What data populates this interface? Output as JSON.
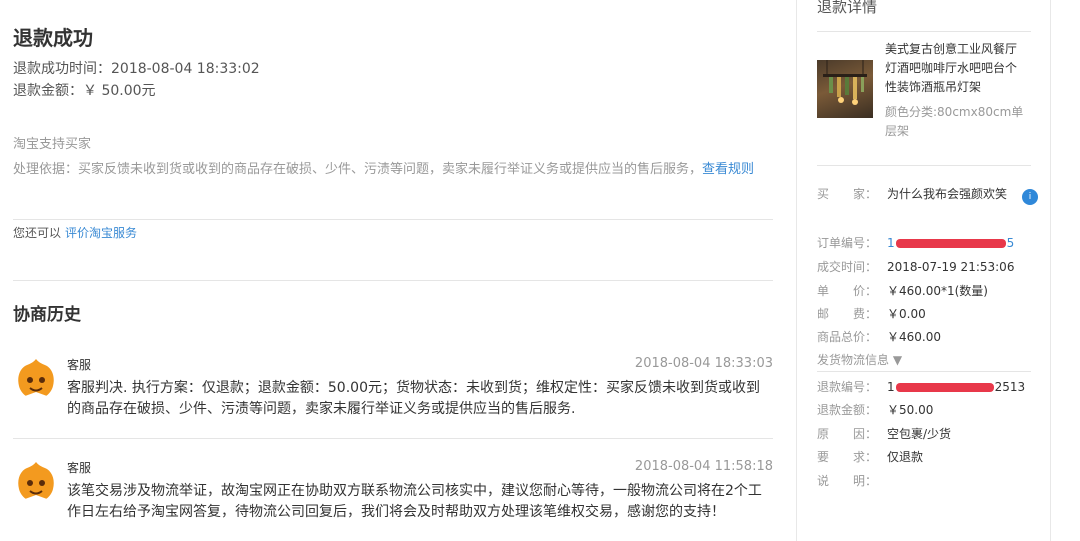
{
  "main": {
    "title": "退款成功",
    "success_time": "退款成功时间：2018-08-04 18:33:02",
    "refund_amount": "退款金额：￥ 50.00元",
    "support_head": "淘宝支持买家",
    "basis_text": "处理依据：买家反馈未收到货或收到的商品存在破损、少件、污渍等问题，卖家未履行举证义务或提供应当的售后服务，",
    "rule_link": "查看规则",
    "also_text": "您还可以",
    "evaluate_link": "评价淘宝服务",
    "history_title": "协商历史",
    "history": [
      {
        "role": "客服",
        "time": "2018-08-04 18:33:03",
        "text": "客服判决. 执行方案：仅退款；退款金额：50.00元；货物状态：未收到货；维权定性：买家反馈未收到货或收到的商品存在破损、少件、污渍等问题，卖家未履行举证义务或提供应当的售后服务."
      },
      {
        "role": "客服",
        "time": "2018-08-04 11:58:18",
        "text": "该笔交易涉及物流举证，故淘宝网正在协助双方联系物流公司核实中，建议您耐心等待，一般物流公司将在2个工作日左右给予淘宝网答复，待物流公司回复后，我们将会及时帮助双方处理该笔维权交易，感谢您的支持！"
      }
    ]
  },
  "sidebar": {
    "title": "退款详情",
    "product_name": "美式复古创意工业风餐厅灯酒吧咖啡厅水吧吧台个性装饰酒瓶吊灯架",
    "product_spec": "颜色分类:80cmx80cm单层架",
    "buyer_label": "买　　家：",
    "buyer_value": "为什么我布会强颜欢笑",
    "info_icon_text": "i",
    "order_label": "订单编号：",
    "order_prefix": "1",
    "order_suffix": "5",
    "deal_time_label": "成交时间：",
    "deal_time_value": "2018-07-19 21:53:06",
    "price_label": "单　　价：",
    "price_value": "￥460.00*1(数量)",
    "shipping_label": "邮　　费：",
    "shipping_value": "￥0.00",
    "total_label": "商品总价：",
    "total_value": "￥460.00",
    "logistics_label": "发货物流信息 ▼",
    "refund_no_label": "退款编号：",
    "refund_no_prefix": "1",
    "refund_no_suffix": "2513",
    "refund_amt_label": "退款金额：",
    "refund_amt_value": "￥50.00",
    "reason_label": "原　　因：",
    "reason_value": "空包裹/少货",
    "request_label": "要　　求：",
    "request_value": "仅退款",
    "note_label": "说　　明：",
    "note_value": ""
  },
  "colors": {
    "link": "#3a8ad4",
    "redaction": "#e8384a",
    "avatar": "#f39a1f"
  }
}
